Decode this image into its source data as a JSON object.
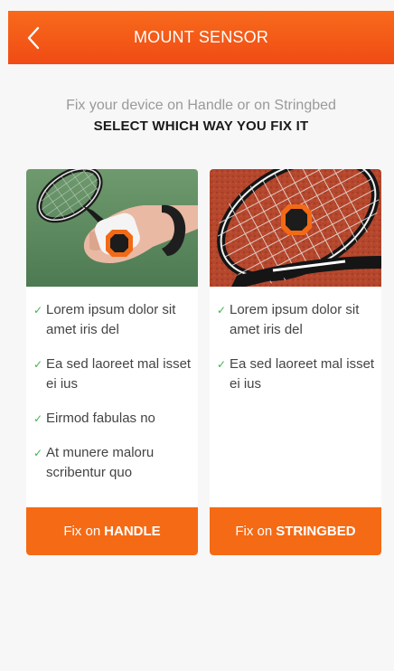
{
  "header": {
    "title": "MOUNT SENSOR",
    "back_icon": "chevron-left-icon"
  },
  "intro": {
    "subtitle": "Fix your device on Handle or on Stringbed",
    "headline": "SELECT WHICH WAY YOU FIX IT"
  },
  "options": [
    {
      "image": "racket-handle-photo",
      "features": [
        "Lorem ipsum dolor sit amet iris del",
        "Ea sed laoreet mal isset ei ius",
        "Eirmod fabulas no",
        "At munere maloru scribentur quo"
      ],
      "button_prefix": "Fix on",
      "button_emphasis": "HANDLE"
    },
    {
      "image": "racket-stringbed-photo",
      "features": [
        "Lorem ipsum dolor sit amet iris del",
        "Ea sed laoreet mal isset ei ius"
      ],
      "button_prefix": "Fix on",
      "button_emphasis": "STRINGBED"
    }
  ],
  "colors": {
    "accent": "#f56a14",
    "check": "#3fb54a",
    "header_top": "#f86a1c",
    "header_bottom": "#f04b14"
  }
}
